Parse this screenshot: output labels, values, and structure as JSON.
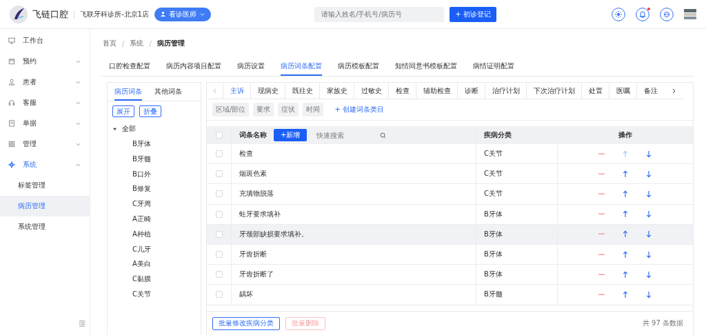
{
  "header": {
    "brand": "飞链口腔",
    "clinic": "飞联牙科诊所-北京1店",
    "role_button": "看诊医师",
    "search": {
      "placeholder": "请输入姓名/手机号/病历号"
    },
    "register_button": "+ 初诊登记",
    "notification_dot": true
  },
  "sidebar": {
    "items": [
      {
        "label": "工作台",
        "expandable": false,
        "selected": false
      },
      {
        "label": "预约",
        "expandable": true,
        "expanded": false,
        "selected": false
      },
      {
        "label": "患者",
        "expandable": true,
        "expanded": false,
        "selected": false
      },
      {
        "label": "客服",
        "expandable": true,
        "expanded": false,
        "selected": false
      },
      {
        "label": "单据",
        "expandable": true,
        "expanded": false,
        "selected": false
      },
      {
        "label": "管理",
        "expandable": true,
        "expanded": false,
        "selected": false
      },
      {
        "label": "系统",
        "expandable": true,
        "expanded": true,
        "selected": true,
        "children": [
          {
            "label": "标签管理",
            "selected": false
          },
          {
            "label": "病历管理",
            "selected": true
          },
          {
            "label": "系统管理",
            "selected": false
          }
        ]
      }
    ]
  },
  "breadcrumb": {
    "separator": "/",
    "items": [
      "首页",
      "系统",
      "病历管理"
    ]
  },
  "tabs": [
    {
      "label": "口腔检查配置",
      "selected": false
    },
    {
      "label": "病历内容项目配置",
      "selected": false
    },
    {
      "label": "病历设置",
      "selected": false
    },
    {
      "label": "病历词条配置",
      "selected": true
    },
    {
      "label": "病历模板配置",
      "selected": false
    },
    {
      "label": "知情同意书模板配置",
      "selected": false
    },
    {
      "label": "病情证明配置",
      "selected": false
    }
  ],
  "left_panel": {
    "tabs": [
      {
        "label": "病历词条",
        "selected": true
      },
      {
        "label": "其他词条",
        "selected": false
      }
    ],
    "buttons": [
      "展开",
      "折叠"
    ],
    "tree": [
      {
        "label": "全部",
        "expanded": true,
        "children": [
          {
            "label": "B牙体"
          },
          {
            "label": "B牙髓"
          },
          {
            "label": "B口外"
          },
          {
            "label": "B修复"
          },
          {
            "label": "C牙周"
          },
          {
            "label": "A正畸"
          },
          {
            "label": "A种植"
          },
          {
            "label": "C儿牙"
          },
          {
            "label": "A美白"
          },
          {
            "label": "C黏膜"
          },
          {
            "label": "C关节"
          }
        ]
      }
    ]
  },
  "section_tabs": [
    {
      "label": "主诉",
      "selected": true
    },
    {
      "label": "现病史",
      "selected": false
    },
    {
      "label": "既往史",
      "selected": false
    },
    {
      "label": "家族史",
      "selected": false
    },
    {
      "label": "过敏史",
      "selected": false
    },
    {
      "label": "检查",
      "selected": false
    },
    {
      "label": "辅助检查",
      "selected": false
    },
    {
      "label": "诊断",
      "selected": false
    },
    {
      "label": "治疗计划",
      "selected": false
    },
    {
      "label": "下次治疗计划",
      "selected": false
    },
    {
      "label": "处置",
      "selected": false
    },
    {
      "label": "医嘱",
      "selected": false
    },
    {
      "label": "备注",
      "selected": false
    }
  ],
  "categories": [
    "区域/部位",
    "要求",
    "症状",
    "时间"
  ],
  "create_category": "+ 创建词条类目",
  "table": {
    "columns": [
      "词条名称",
      "疾病分类",
      "操作"
    ],
    "add_button": "+新增",
    "select_all": false,
    "search": {
      "placeholder": "快速搜索"
    },
    "rows": [
      {
        "name": "检查",
        "category": "C关节",
        "checked": false,
        "highlighted": false,
        "up_disabled": true
      },
      {
        "name": "烟斑色素",
        "category": "C关节",
        "checked": false,
        "highlighted": false,
        "up_disabled": false
      },
      {
        "name": "充填物脱落",
        "category": "C关节",
        "checked": false,
        "highlighted": false,
        "up_disabled": false
      },
      {
        "name": "蛀牙要求填补",
        "category": "B牙体",
        "checked": false,
        "highlighted": false,
        "up_disabled": false
      },
      {
        "name": "牙颈部缺损要求填补。",
        "category": "B牙体",
        "checked": false,
        "highlighted": true,
        "up_disabled": false
      },
      {
        "name": "牙齿折断",
        "category": "B牙体",
        "checked": false,
        "highlighted": false,
        "up_disabled": false
      },
      {
        "name": "牙齿折断了",
        "category": "B牙体",
        "checked": false,
        "highlighted": false,
        "up_disabled": false
      },
      {
        "name": "龋坏",
        "category": "B牙髓",
        "checked": false,
        "highlighted": false,
        "up_disabled": false
      }
    ]
  },
  "footer": {
    "batch_edit": "批量修改疾病分类",
    "batch_delete": "批量删除",
    "batch_delete_disabled": true,
    "total": "共 97 条数据"
  }
}
